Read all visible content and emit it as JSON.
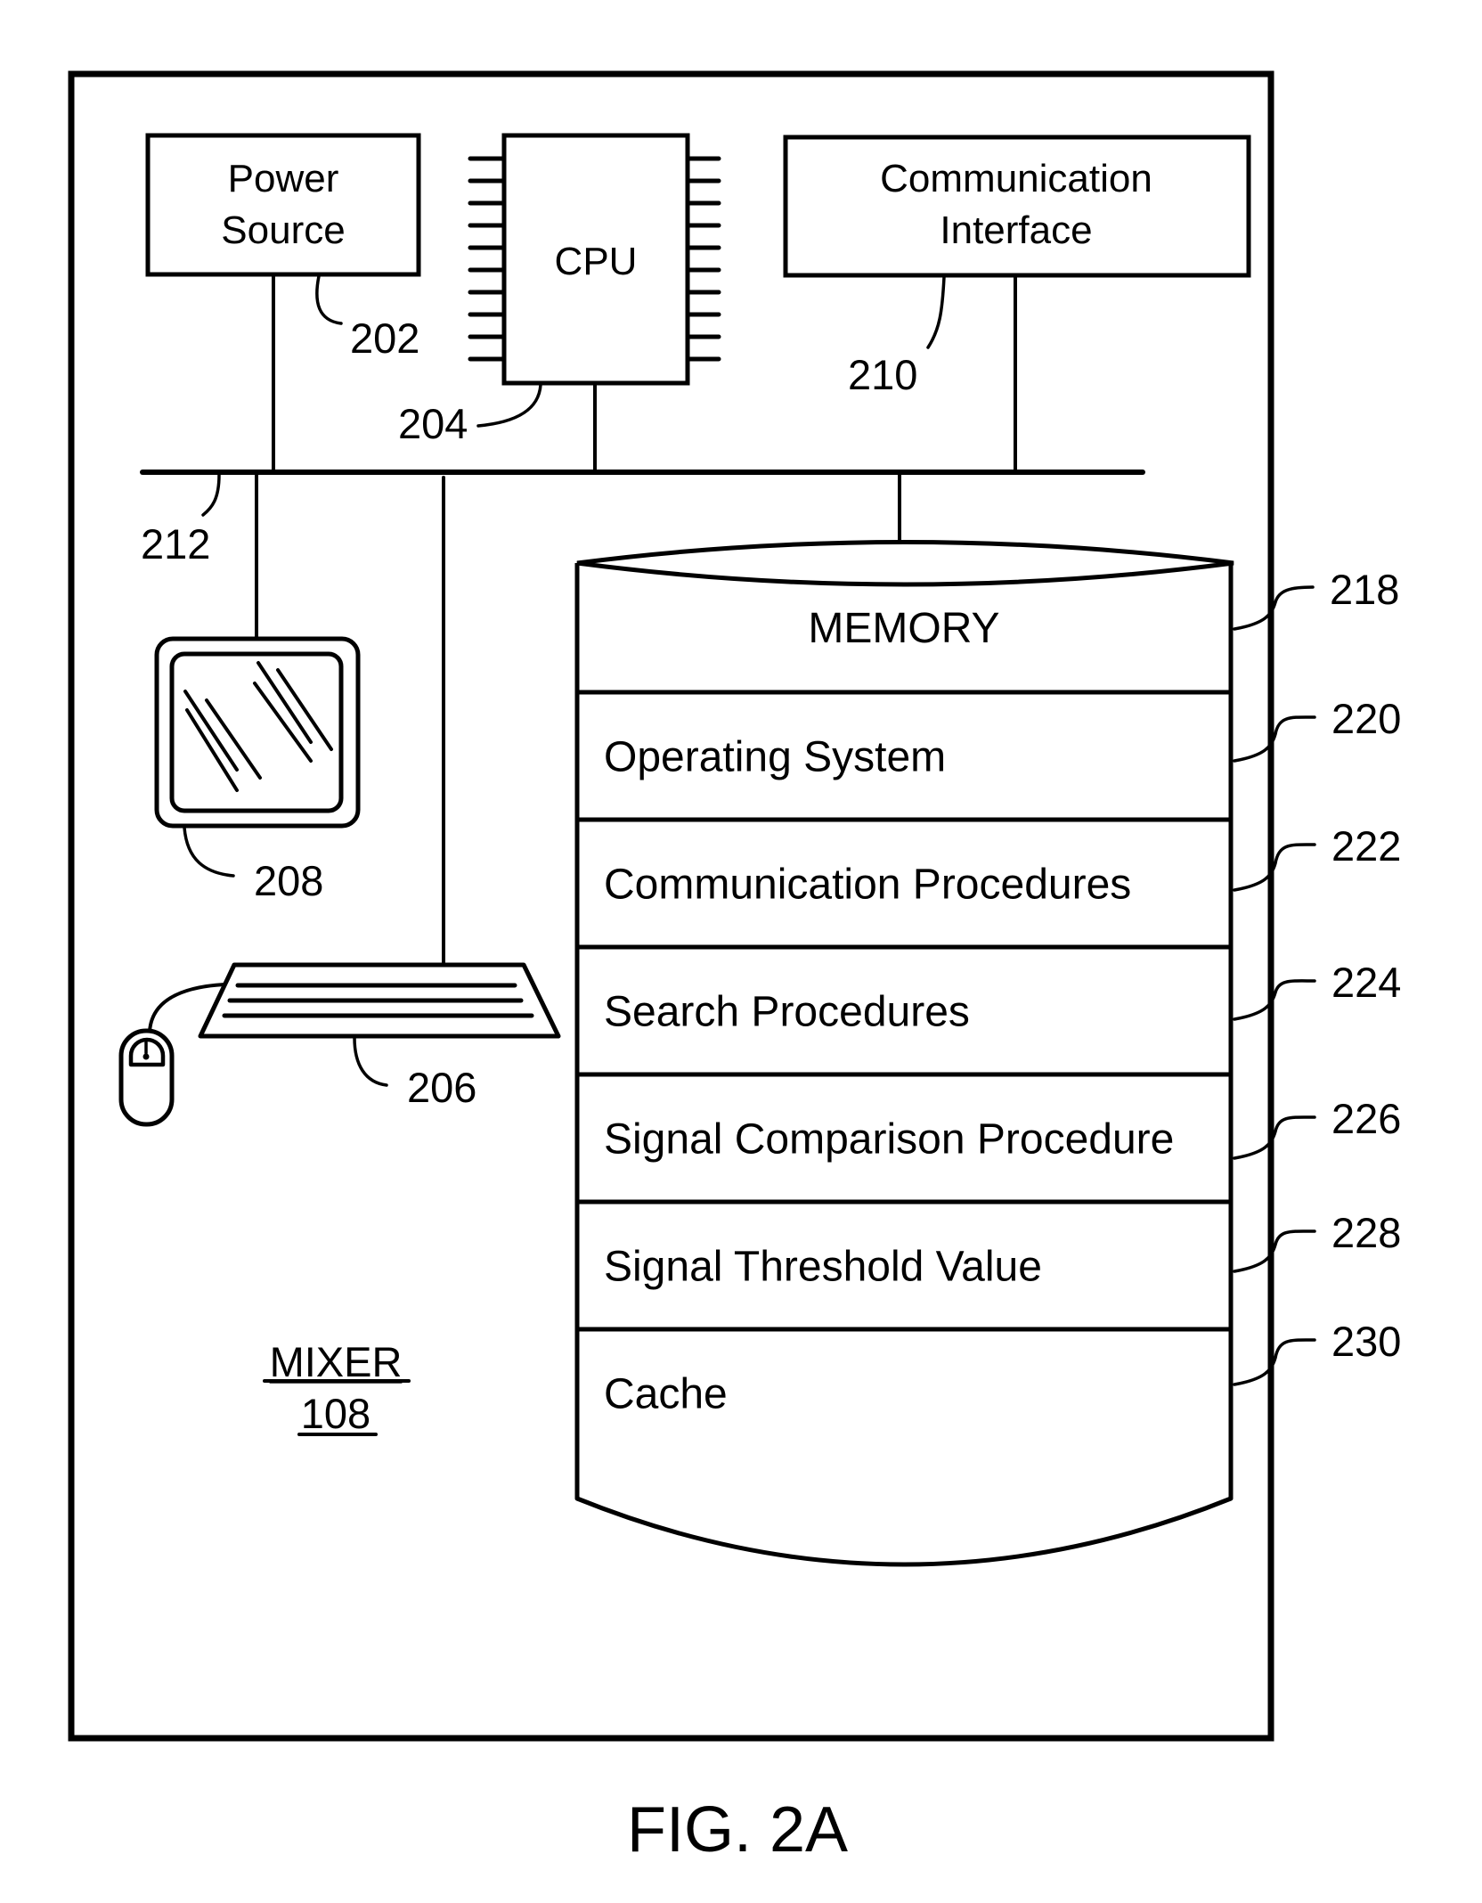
{
  "figure": {
    "caption": "FIG. 2A",
    "device": {
      "name": "MIXER",
      "number": "108"
    }
  },
  "components": {
    "power_source": {
      "lines": [
        "Power",
        "Source"
      ],
      "ref": "202"
    },
    "cpu": {
      "label": "CPU",
      "ref": "204"
    },
    "communication_interface": {
      "lines": [
        "Communication",
        "Interface"
      ],
      "ref": "210"
    },
    "bus": {
      "ref": "212"
    },
    "display": {
      "ref": "208",
      "icon": "monitor-icon"
    },
    "input_devices": {
      "ref": "206",
      "icons": [
        "keyboard-icon",
        "mouse-icon"
      ]
    }
  },
  "memory": {
    "title": "MEMORY",
    "title_ref": "218",
    "rows": [
      {
        "label": "Operating System",
        "ref": "220"
      },
      {
        "label": "Communication Procedures",
        "ref": "222"
      },
      {
        "label": "Search Procedures",
        "ref": "224"
      },
      {
        "label": "Signal Comparison Procedure",
        "ref": "226"
      },
      {
        "label": "Signal Threshold Value",
        "ref": "228"
      },
      {
        "label": "Cache",
        "ref": "230"
      }
    ]
  }
}
